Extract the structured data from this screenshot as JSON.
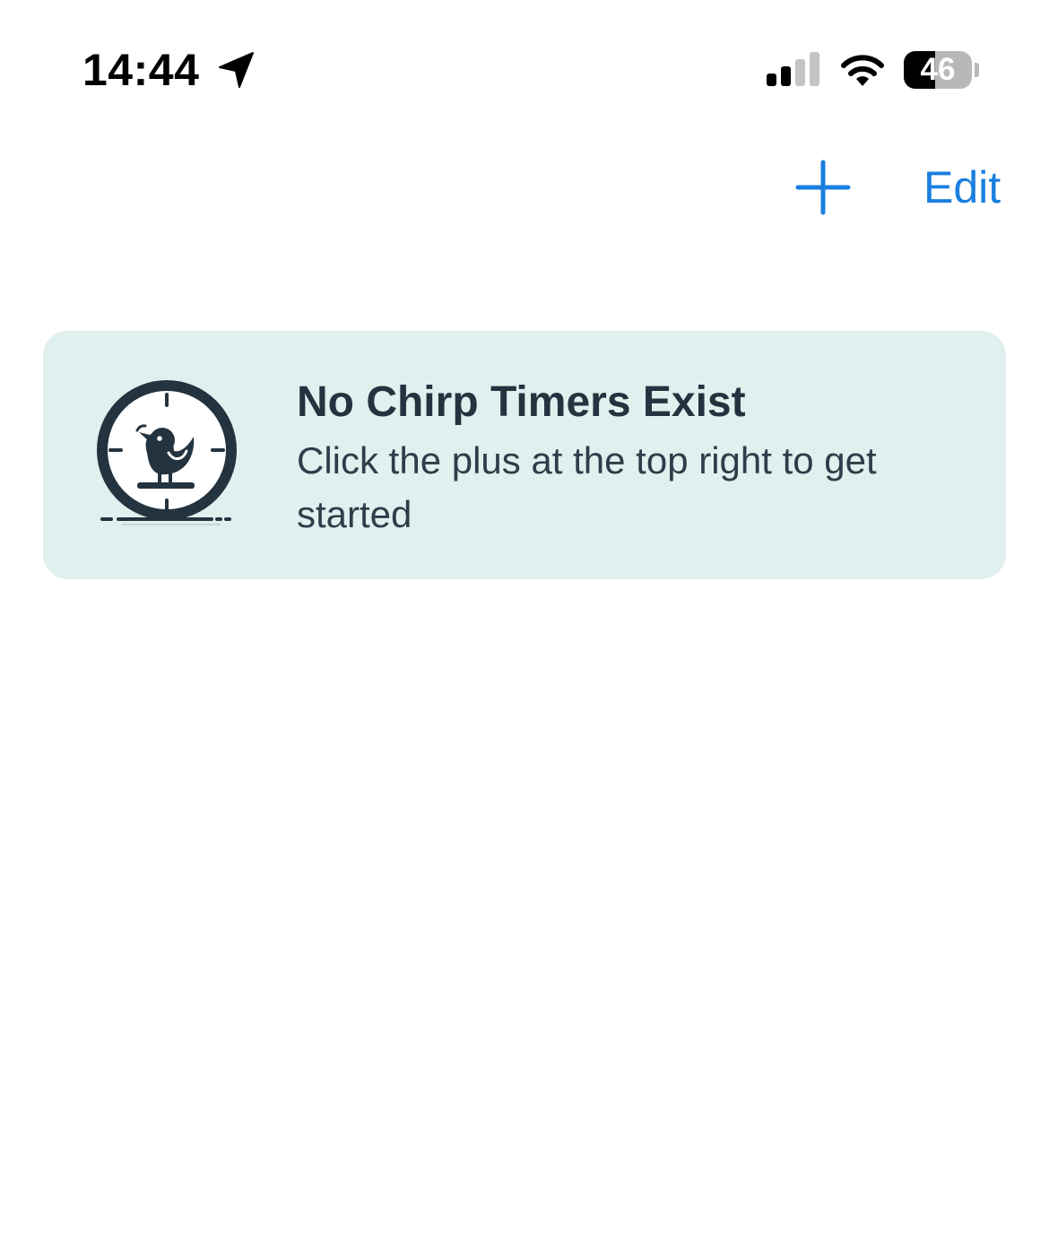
{
  "status_bar": {
    "time": "14:44",
    "battery_level": "46",
    "battery_fraction": 0.46,
    "icons": {
      "location": "location-arrow-icon",
      "signal": "cellular-signal-icon",
      "wifi": "wifi-icon"
    }
  },
  "nav": {
    "add_icon": "plus-icon",
    "edit_label": "Edit",
    "accent_color": "#1a7fe0"
  },
  "empty_state": {
    "icon": "bird-clock-icon",
    "title": "No Chirp Timers Exist",
    "message": "Click the plus at the top right to get started",
    "background_color": "#dff0ee",
    "text_color": "#23333f"
  }
}
